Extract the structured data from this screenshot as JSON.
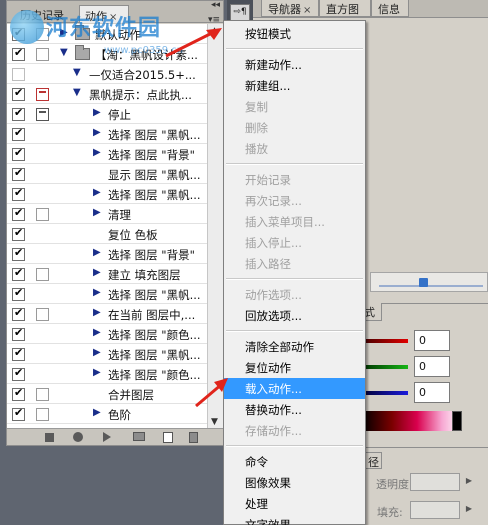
{
  "panel": {
    "tabs": [
      {
        "label": "历史记录",
        "active": false
      },
      {
        "label": "动作",
        "active": true,
        "close": "×"
      }
    ],
    "menu_button": "▾≡",
    "collapse": "◂◂",
    "rows": [
      {
        "checked": true,
        "dialog": "empty",
        "indent": "set",
        "label": "默认动作"
      },
      {
        "checked": true,
        "dialog": "empty",
        "indent": "set-open",
        "label": "【淘：黑帆设计素..."
      },
      {
        "checked": false,
        "dialog": "none",
        "indent": "action-open",
        "label": "—仅适合2015.5+..."
      },
      {
        "checked": true,
        "dialog": "red",
        "indent": "action-open",
        "label": "黑帆提示：点此执..."
      },
      {
        "checked": true,
        "dialog": "on",
        "indent": "step",
        "label": "停止"
      },
      {
        "checked": true,
        "dialog": "none",
        "indent": "step",
        "label": "选择 图层 \"黑帆..."
      },
      {
        "checked": true,
        "dialog": "none",
        "indent": "step",
        "label": "选择 图层 \"背景\""
      },
      {
        "checked": true,
        "dialog": "none",
        "indent": "step-plain",
        "label": "显示 图层 \"黑帆..."
      },
      {
        "checked": true,
        "dialog": "none",
        "indent": "step",
        "label": "选择 图层 \"黑帆..."
      },
      {
        "checked": true,
        "dialog": "empty",
        "indent": "step",
        "label": "清理"
      },
      {
        "checked": true,
        "dialog": "none",
        "indent": "step-plain",
        "label": "复位 色板"
      },
      {
        "checked": true,
        "dialog": "none",
        "indent": "step",
        "label": "选择 图层 \"背景\""
      },
      {
        "checked": true,
        "dialog": "empty",
        "indent": "step",
        "label": "建立 填充图层"
      },
      {
        "checked": true,
        "dialog": "none",
        "indent": "step",
        "label": "选择 图层 \"黑帆..."
      },
      {
        "checked": true,
        "dialog": "empty",
        "indent": "step",
        "label": "在当前 图层中,..."
      },
      {
        "checked": true,
        "dialog": "none",
        "indent": "step",
        "label": "选择 图层 \"颜色..."
      },
      {
        "checked": true,
        "dialog": "none",
        "indent": "step",
        "label": "选择 图层 \"黑帆..."
      },
      {
        "checked": true,
        "dialog": "none",
        "indent": "step",
        "label": "选择 图层 \"颜色..."
      },
      {
        "checked": true,
        "dialog": "empty",
        "indent": "step-plain",
        "label": "合并图层"
      },
      {
        "checked": true,
        "dialog": "empty",
        "indent": "step",
        "label": "色阶"
      }
    ]
  },
  "right": {
    "tabs": [
      {
        "label": "导航器",
        "close": "×"
      },
      {
        "label": "直方图"
      },
      {
        "label": "信息"
      }
    ],
    "color_tab": "式",
    "rgb_values": [
      "0",
      "0",
      "0"
    ],
    "layers_tab": "径",
    "opacity_label": "透明度:",
    "fill_label": "填充:"
  },
  "toolbtn": "⇨¶",
  "menu": {
    "items": [
      {
        "label": "按钮模式",
        "state": "normal"
      },
      {
        "sep": true
      },
      {
        "label": "新建动作...",
        "state": "normal"
      },
      {
        "label": "新建组...",
        "state": "normal"
      },
      {
        "label": "复制",
        "state": "disabled"
      },
      {
        "label": "删除",
        "state": "disabled"
      },
      {
        "label": "播放",
        "state": "disabled"
      },
      {
        "sep": true
      },
      {
        "label": "开始记录",
        "state": "disabled"
      },
      {
        "label": "再次记录...",
        "state": "disabled"
      },
      {
        "label": "插入菜单项目...",
        "state": "disabled"
      },
      {
        "label": "插入停止...",
        "state": "disabled"
      },
      {
        "label": "插入路径",
        "state": "disabled"
      },
      {
        "sep": true
      },
      {
        "label": "动作选项...",
        "state": "disabled"
      },
      {
        "label": "回放选项...",
        "state": "normal"
      },
      {
        "sep": true
      },
      {
        "label": "清除全部动作",
        "state": "normal"
      },
      {
        "label": "复位动作",
        "state": "normal"
      },
      {
        "label": "载入动作...",
        "state": "highlighted"
      },
      {
        "label": "替换动作...",
        "state": "normal"
      },
      {
        "label": "存储动作...",
        "state": "disabled"
      },
      {
        "sep": true
      },
      {
        "label": "命令",
        "state": "normal"
      },
      {
        "label": "图像效果",
        "state": "normal"
      },
      {
        "label": "处理",
        "state": "normal"
      },
      {
        "label": "文字效果",
        "state": "normal"
      }
    ]
  },
  "watermark": {
    "text": "河东软件园",
    "url": "www.pc0359.cn"
  },
  "colors": {
    "menu_highlight": "#3399ff",
    "arrow": "#e0241b"
  }
}
